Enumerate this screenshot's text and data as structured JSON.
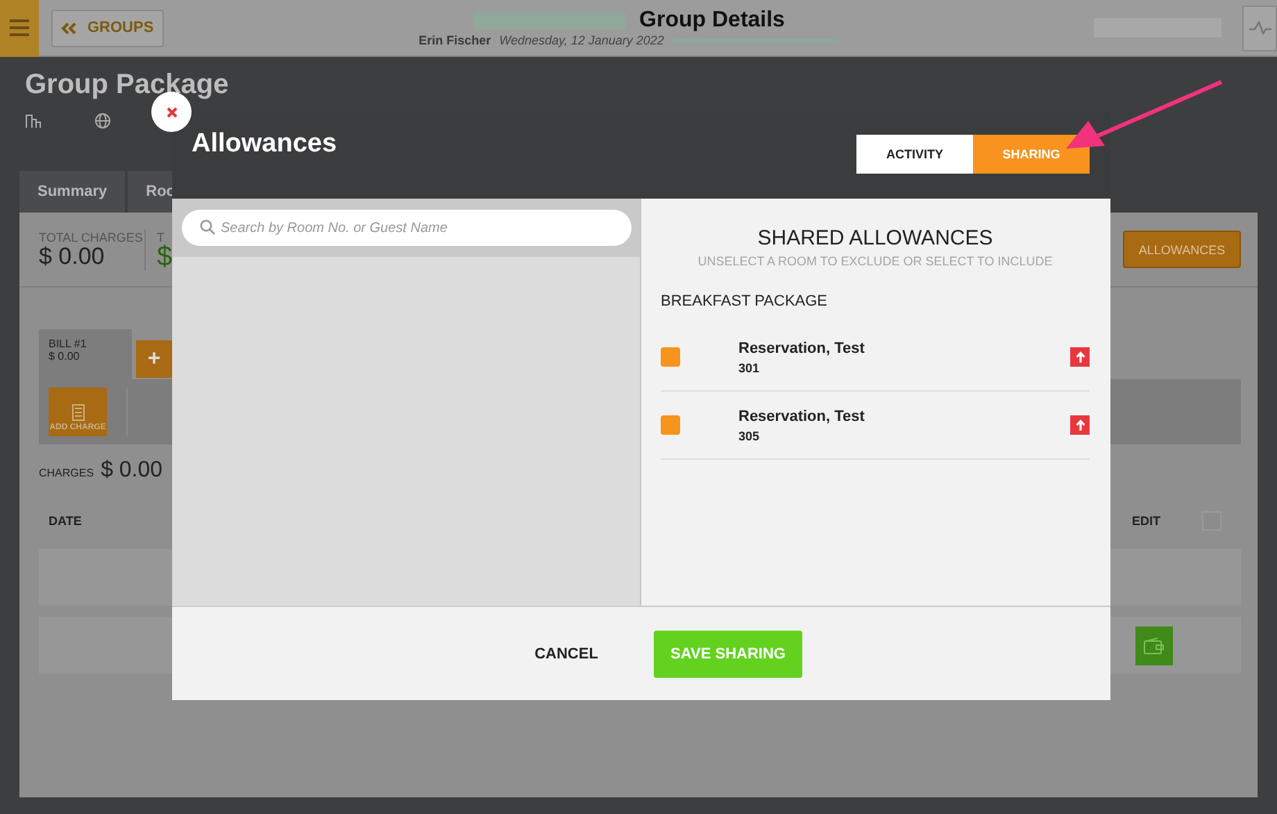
{
  "top_bar": {
    "back_button": "GROUPS",
    "title": "Group Details",
    "user": "Erin Fischer",
    "date": "Wednesday, 12 January 2022"
  },
  "page": {
    "title": "Group Package",
    "tabs": [
      "Summary",
      "Roo"
    ],
    "totals": [
      {
        "label": "TOTAL CHARGES",
        "value": "$ 0.00",
        "color": "#222222"
      },
      {
        "label": "T",
        "value": "$",
        "color": "#2a6410"
      }
    ],
    "allowances_button": "ALLOWANCES",
    "bill": {
      "label": "BILL #1",
      "amount": "$ 0.00"
    },
    "add_bill": "+",
    "add_charge": "ADD CHARGE",
    "charges_label": "CHARGES",
    "charges_total": "$ 0.00",
    "columns": [
      "DATE",
      "EDIT"
    ],
    "edit_checked": false
  },
  "dialog": {
    "title": "Allowances",
    "modes": [
      {
        "label": "ACTIVITY",
        "selected": false
      },
      {
        "label": "SHARING",
        "selected": true
      }
    ],
    "search": {
      "placeholder": "Search by Room No. or Guest Name"
    },
    "heading": "SHARED ALLOWANCES",
    "subheading": "UNSELECT A ROOM TO EXCLUDE OR SELECT TO INCLUDE",
    "packages": [
      {
        "name": "BREAKFAST PACKAGE",
        "rooms": [
          {
            "guest": "Reservation, Test",
            "room": "301",
            "checked": true
          },
          {
            "guest": "Reservation, Test",
            "room": "305",
            "checked": true
          }
        ]
      }
    ],
    "cancel": "CANCEL",
    "save": "SAVE SHARING"
  }
}
